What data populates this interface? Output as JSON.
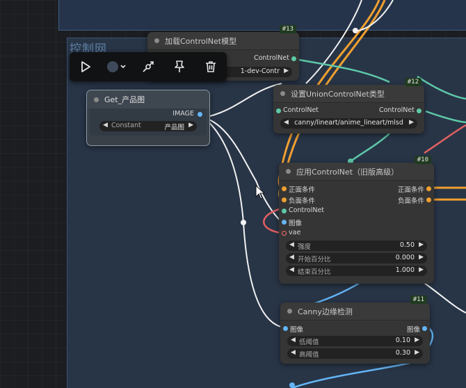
{
  "group": {
    "title": "控制网"
  },
  "toolbar": {
    "buttons": [
      {
        "icon": "play-icon"
      },
      {
        "icon": "color-circle-icon"
      },
      {
        "icon": "bypass-icon"
      },
      {
        "icon": "pin-icon"
      },
      {
        "icon": "trash-icon"
      }
    ]
  },
  "nodes": {
    "load_controlnet": {
      "badge": "#13",
      "title": "加载ControlNet模型",
      "output": "ControlNet",
      "model_value": "1-dev-Contr"
    },
    "get_image": {
      "title": "Get_产品图",
      "output": "IMAGE",
      "widget_label": "Constant",
      "widget_value": "产品图"
    },
    "union_type": {
      "badge": "#12",
      "title": "设置UnionControlNet类型",
      "input": "ControlNet",
      "output": "ControlNet",
      "type_value": "canny/lineart/anime_lineart/mlsd"
    },
    "apply_controlnet": {
      "badge": "#10",
      "title": "应用ControlNet（旧版高级）",
      "inputs": [
        "正面条件",
        "负面条件",
        "ControlNet",
        "图像",
        "vae"
      ],
      "outputs": [
        "正面条件",
        "负面条件"
      ],
      "widgets": [
        {
          "label": "强度",
          "value": "0.50"
        },
        {
          "label": "开始百分比",
          "value": "0.000"
        },
        {
          "label": "结束百分比",
          "value": "1.000"
        }
      ]
    },
    "canny": {
      "badge": "#11",
      "title": "Canny边缘检测",
      "input": "图像",
      "output": "图像",
      "widgets": [
        {
          "label": "低阈值",
          "value": "0.10"
        },
        {
          "label": "高阈值",
          "value": "0.30"
        }
      ]
    }
  },
  "colors": {
    "conditioning": "#f0a030",
    "controlnet": "#5ec9a8",
    "image": "#64b5f6",
    "vae": "#ff6e6e",
    "wire_white": "#f2f2f2"
  }
}
